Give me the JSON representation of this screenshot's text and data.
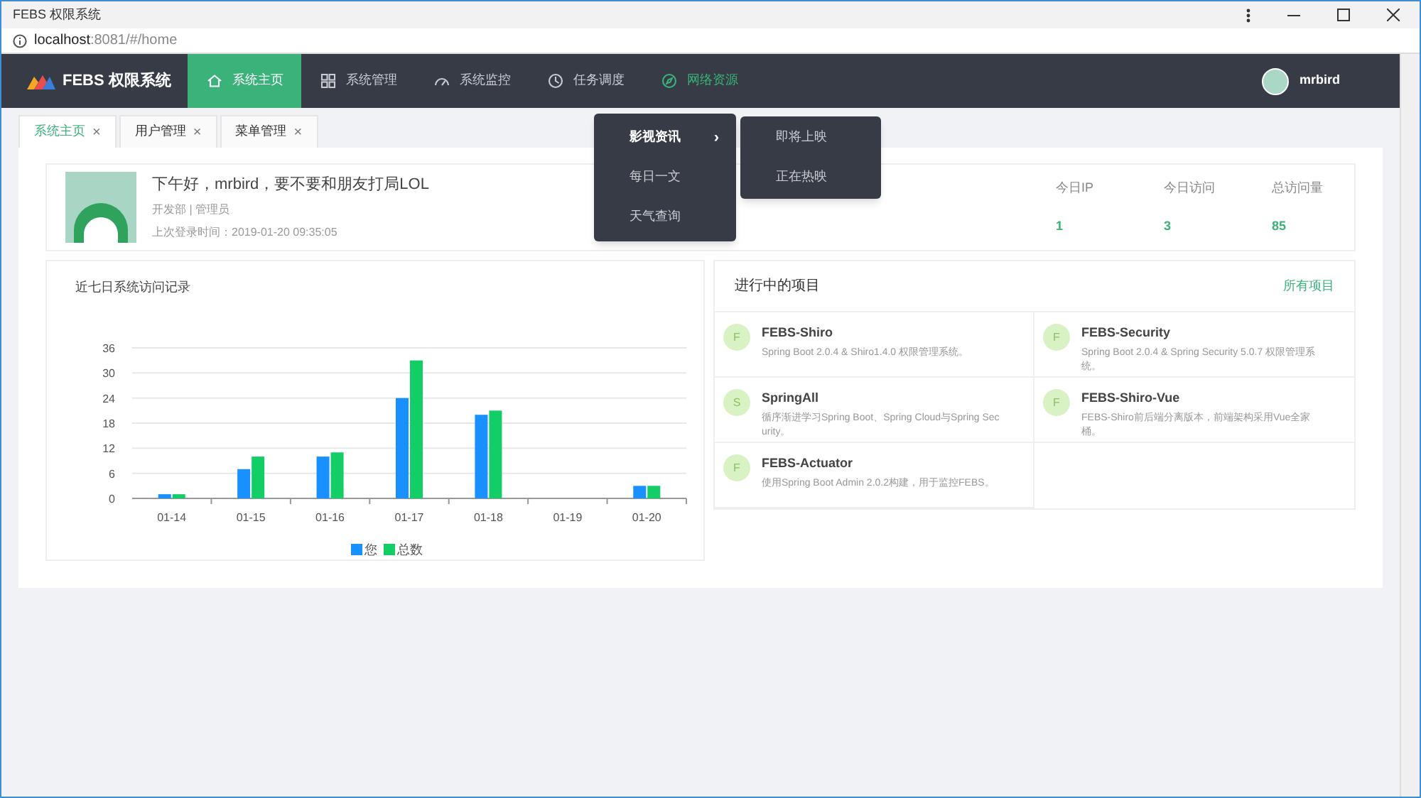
{
  "window": {
    "title": "FEBS 权限系统",
    "url_host": "localhost",
    "url_rest": ":8081/#/home"
  },
  "header": {
    "brand": "FEBS 权限系统",
    "user": "mrbird",
    "nav": [
      {
        "label": "系统主页",
        "selected": true,
        "open": false
      },
      {
        "label": "系统管理",
        "selected": false,
        "open": false
      },
      {
        "label": "系统监控",
        "selected": false,
        "open": false
      },
      {
        "label": "任务调度",
        "selected": false,
        "open": false
      },
      {
        "label": "网络资源",
        "selected": false,
        "open": true
      }
    ]
  },
  "menu": {
    "items": [
      {
        "label": "影视资讯",
        "active": true,
        "submenu_arrow": "›"
      },
      {
        "label": "每日一文",
        "active": false
      },
      {
        "label": "天气查询",
        "active": false
      }
    ],
    "submenu": [
      "即将上映",
      "正在热映"
    ]
  },
  "tabs": [
    {
      "label": "系统主页",
      "selected": true,
      "close": "×"
    },
    {
      "label": "用户管理",
      "selected": false,
      "close": "×"
    },
    {
      "label": "菜单管理",
      "selected": false,
      "close": "×"
    }
  ],
  "welcome": {
    "greeting": "下午好，mrbird，要不要和朋友打局LOL",
    "dept": "开发部 | 管理员",
    "last_login": "上次登录时间：2019-01-20 09:35:05"
  },
  "stats": [
    {
      "label": "今日IP",
      "value": "1"
    },
    {
      "label": "今日访问",
      "value": "3"
    },
    {
      "label": "总访问量",
      "value": "85"
    }
  ],
  "chart_panel": {
    "title": "近七日系统访问记录",
    "chart_data": {
      "type": "bar",
      "categories": [
        "01-14",
        "01-15",
        "01-16",
        "01-17",
        "01-18",
        "01-19",
        "01-20"
      ],
      "series": [
        {
          "name": "您",
          "color": "#1890ff",
          "values": [
            1,
            7,
            10,
            24,
            20,
            0,
            3
          ]
        },
        {
          "name": "总数",
          "color": "#13ce66",
          "values": [
            1,
            10,
            11,
            33,
            21,
            0,
            3
          ]
        }
      ],
      "ylim": [
        0,
        36
      ],
      "grid": true,
      "yticks": [
        0,
        6,
        12,
        18,
        24,
        30,
        36
      ]
    }
  },
  "projects": {
    "title": "进行中的项目",
    "link": "所有项目",
    "items": [
      {
        "initial": "F",
        "name": "FEBS-Shiro",
        "desc": "Spring Boot 2.0.4 & Shiro1.4.0 权限管理系统。"
      },
      {
        "initial": "F",
        "name": "FEBS-Security",
        "desc": "Spring Boot 2.0.4 & Spring Security 5.0.7 权限管理系统。"
      },
      {
        "initial": "S",
        "name": "SpringAll",
        "desc": "循序渐进学习Spring Boot、Spring Cloud与Spring Security。"
      },
      {
        "initial": "F",
        "name": "FEBS-Shiro-Vue",
        "desc": "FEBS-Shiro前后端分离版本，前端架构采用Vue全家桶。"
      },
      {
        "initial": "F",
        "name": "FEBS-Actuator",
        "desc": "使用Spring Boot Admin 2.0.2构建，用于监控FEBS。"
      }
    ]
  }
}
